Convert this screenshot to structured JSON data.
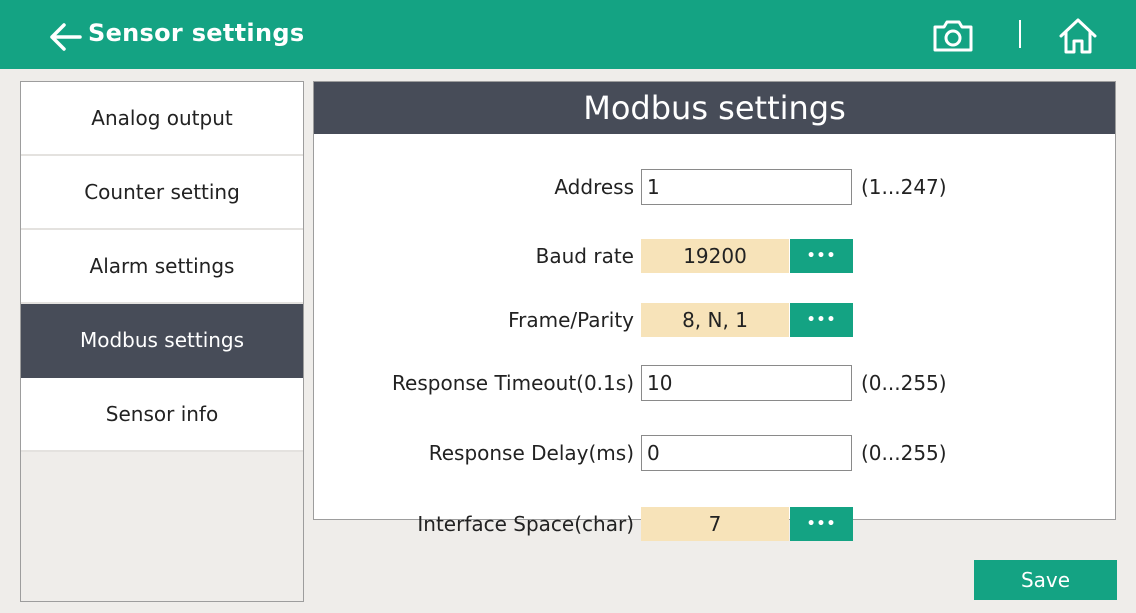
{
  "header": {
    "title": "Sensor settings",
    "back_icon": "arrow-left-icon",
    "camera_icon": "camera-icon",
    "home_icon": "home-icon"
  },
  "sidebar": {
    "items": [
      {
        "label": "Analog output",
        "active": false
      },
      {
        "label": "Counter setting",
        "active": false
      },
      {
        "label": "Alarm settings",
        "active": false
      },
      {
        "label": "Modbus settings",
        "active": true
      },
      {
        "label": "Sensor info",
        "active": false
      }
    ]
  },
  "panel": {
    "title": "Modbus settings",
    "address": {
      "label": "Address",
      "value": "1",
      "range": "(1...247)"
    },
    "baud_rate": {
      "label": "Baud rate",
      "value": "19200",
      "more": "•••"
    },
    "frame_parity": {
      "label": "Frame/Parity",
      "value": "8, N, 1",
      "more": "•••"
    },
    "response_timeout": {
      "label": "Response Timeout(0.1s)",
      "value": "10",
      "range": "(0...255)"
    },
    "response_delay": {
      "label": "Response Delay(ms)",
      "value": "0",
      "range": "(0...255)"
    },
    "interface_space": {
      "label": "Interface Space(char)",
      "value": "7",
      "more": "•••"
    }
  },
  "footer": {
    "save_label": "Save"
  },
  "colors": {
    "accent": "#14a383",
    "dark": "#474c58",
    "value_bg": "#f7e3b9",
    "background": "#efedea"
  }
}
